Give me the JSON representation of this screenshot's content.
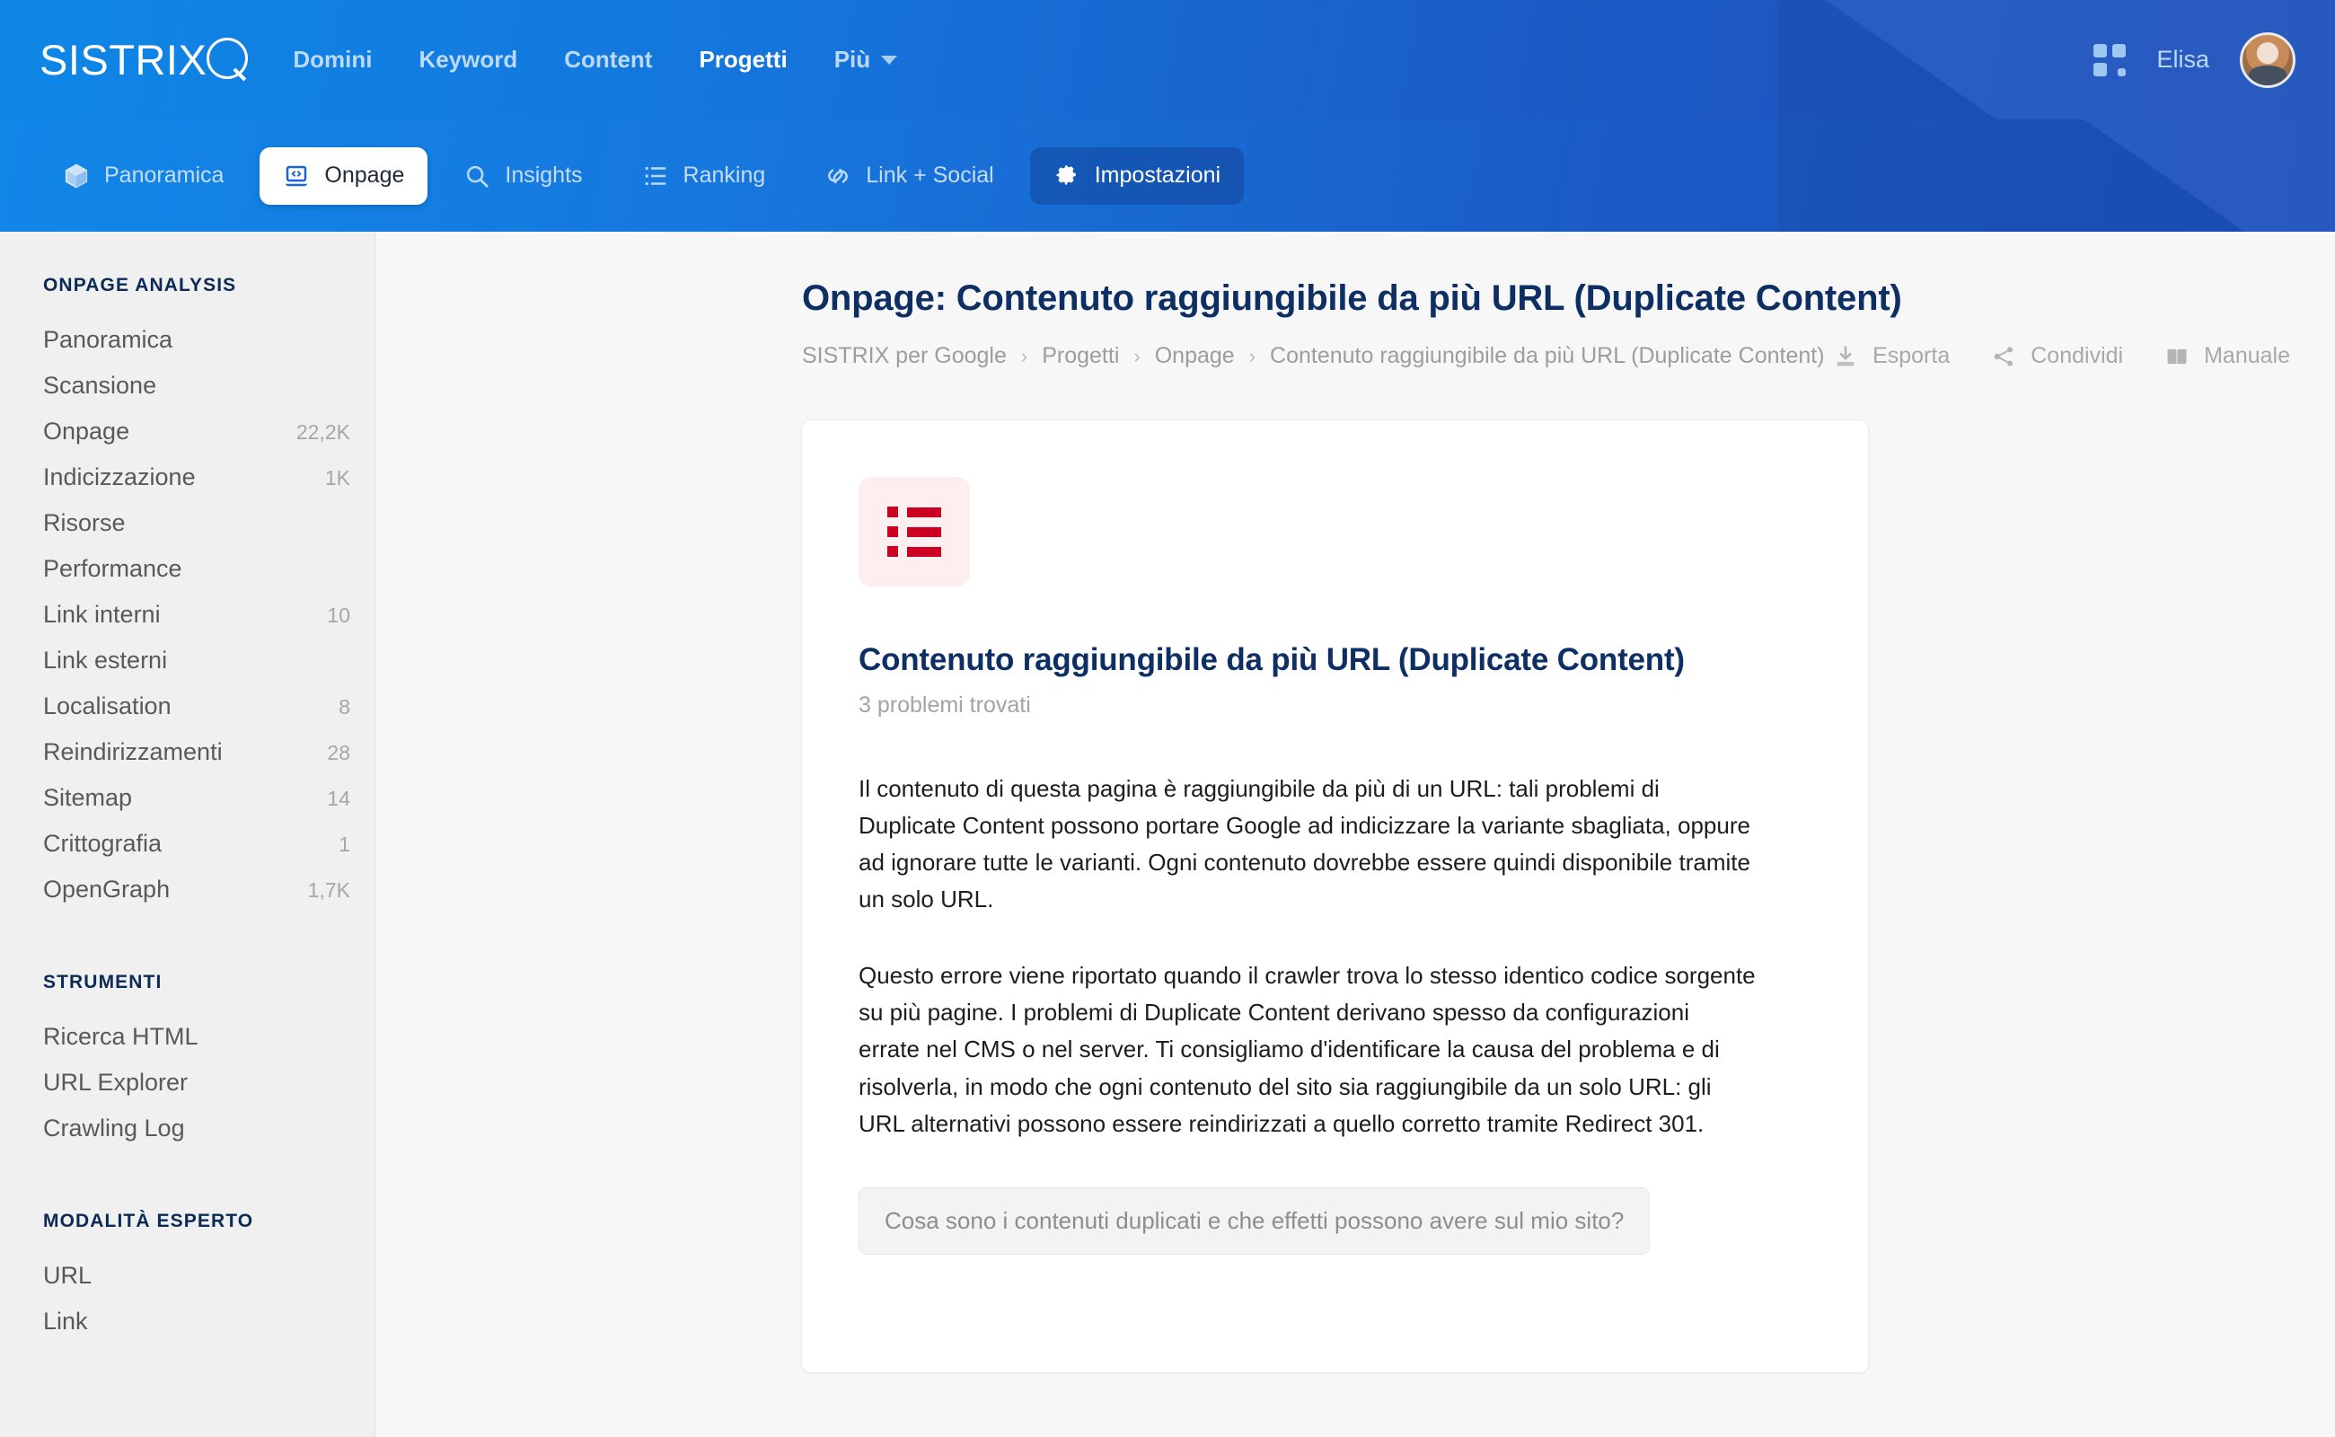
{
  "header": {
    "brand": "SISTRIX",
    "brand_icon": "magnifier-icon",
    "nav": [
      {
        "label": "Domini",
        "active": false
      },
      {
        "label": "Keyword",
        "active": false
      },
      {
        "label": "Content",
        "active": false
      },
      {
        "label": "Progetti",
        "active": true
      },
      {
        "label": "Più",
        "active": false
      }
    ],
    "apps_icon": "grid-apps-icon",
    "username": "Elisa",
    "avatar_alt": "user-avatar"
  },
  "subnav": {
    "tabs": [
      {
        "label": "Panoramica",
        "icon": "cube-icon",
        "state": "normal"
      },
      {
        "label": "Onpage",
        "icon": "laptop-code-icon",
        "state": "selected"
      },
      {
        "label": "Insights",
        "icon": "magnifier-icon",
        "state": "normal"
      },
      {
        "label": "Ranking",
        "icon": "list-ranking-icon",
        "state": "normal"
      },
      {
        "label": "Link + Social",
        "icon": "link-icon",
        "state": "normal"
      },
      {
        "label": "Impostazioni",
        "icon": "gear-icon",
        "state": "highlighted"
      }
    ]
  },
  "sidebar": {
    "sections": [
      {
        "title": "ONPAGE ANALYSIS",
        "items": [
          {
            "label": "Panoramica",
            "count": ""
          },
          {
            "label": "Scansione",
            "count": ""
          },
          {
            "label": "Onpage",
            "count": "22,2K"
          },
          {
            "label": "Indicizzazione",
            "count": "1K"
          },
          {
            "label": "Risorse",
            "count": ""
          },
          {
            "label": "Performance",
            "count": ""
          },
          {
            "label": "Link interni",
            "count": "10"
          },
          {
            "label": "Link esterni",
            "count": ""
          },
          {
            "label": "Localisation",
            "count": "8"
          },
          {
            "label": "Reindirizzamenti",
            "count": "28"
          },
          {
            "label": "Sitemap",
            "count": "14"
          },
          {
            "label": "Crittografia",
            "count": "1"
          },
          {
            "label": "OpenGraph",
            "count": "1,7K"
          }
        ]
      },
      {
        "title": "STRUMENTI",
        "items": [
          {
            "label": "Ricerca HTML",
            "count": ""
          },
          {
            "label": "URL Explorer",
            "count": ""
          },
          {
            "label": "Crawling Log",
            "count": ""
          }
        ]
      },
      {
        "title": "MODALITÀ ESPERTO",
        "items": [
          {
            "label": "URL",
            "count": ""
          },
          {
            "label": "Link",
            "count": ""
          }
        ]
      }
    ]
  },
  "main": {
    "page_title": "Onpage: Contenuto raggiungibile da più URL (Duplicate Content)",
    "breadcrumb": [
      "SISTRIX per Google",
      "Progetti",
      "Onpage",
      "Contenuto raggiungibile da più URL (Duplicate Content)"
    ],
    "breadcrumb_separator": "›",
    "actions": [
      {
        "label": "Esporta",
        "icon": "download-icon"
      },
      {
        "label": "Condividi",
        "icon": "share-icon"
      },
      {
        "label": "Manuale",
        "icon": "book-icon"
      }
    ],
    "card": {
      "icon": "bulleted-list-icon",
      "icon_color": "#cc0022",
      "icon_bg": "#fdeef0",
      "title": "Contenuto raggiungibile da più URL (Duplicate Content)",
      "subtitle": "3 problemi trovati",
      "paragraphs": [
        "Il contenuto di questa pagina è raggiungibile da più di un URL: tali problemi di Duplicate Content possono portare Google ad indicizzare la variante sbagliata, oppure ad ignorare tutte le varianti. Ogni contenuto dovrebbe essere quindi disponibile tramite un solo URL.",
        "Questo errore viene riportato quando il crawler trova lo stesso identico codice sorgente su più pagine. I problemi di Duplicate Content derivano spesso da configurazioni errate nel CMS o nel server. Ti consigliamo d'identificare la causa del problema e di risolverla, in modo che ogni contenuto del sito sia raggiungibile da un solo URL: gli URL alternativi possono essere reindirizzati a quello corretto tramite Redirect 301."
      ],
      "question_button": "Cosa sono i contenuti duplicati e che effetti possono avere sul mio sito?"
    }
  },
  "colors": {
    "brand_blue_light": "#0e87e6",
    "brand_blue_dark": "#1b4fbb",
    "title_navy": "#0d2f63",
    "accent_red": "#cc0022",
    "sidebar_bg": "#f0f0f0",
    "content_bg": "#f7f7f8"
  }
}
